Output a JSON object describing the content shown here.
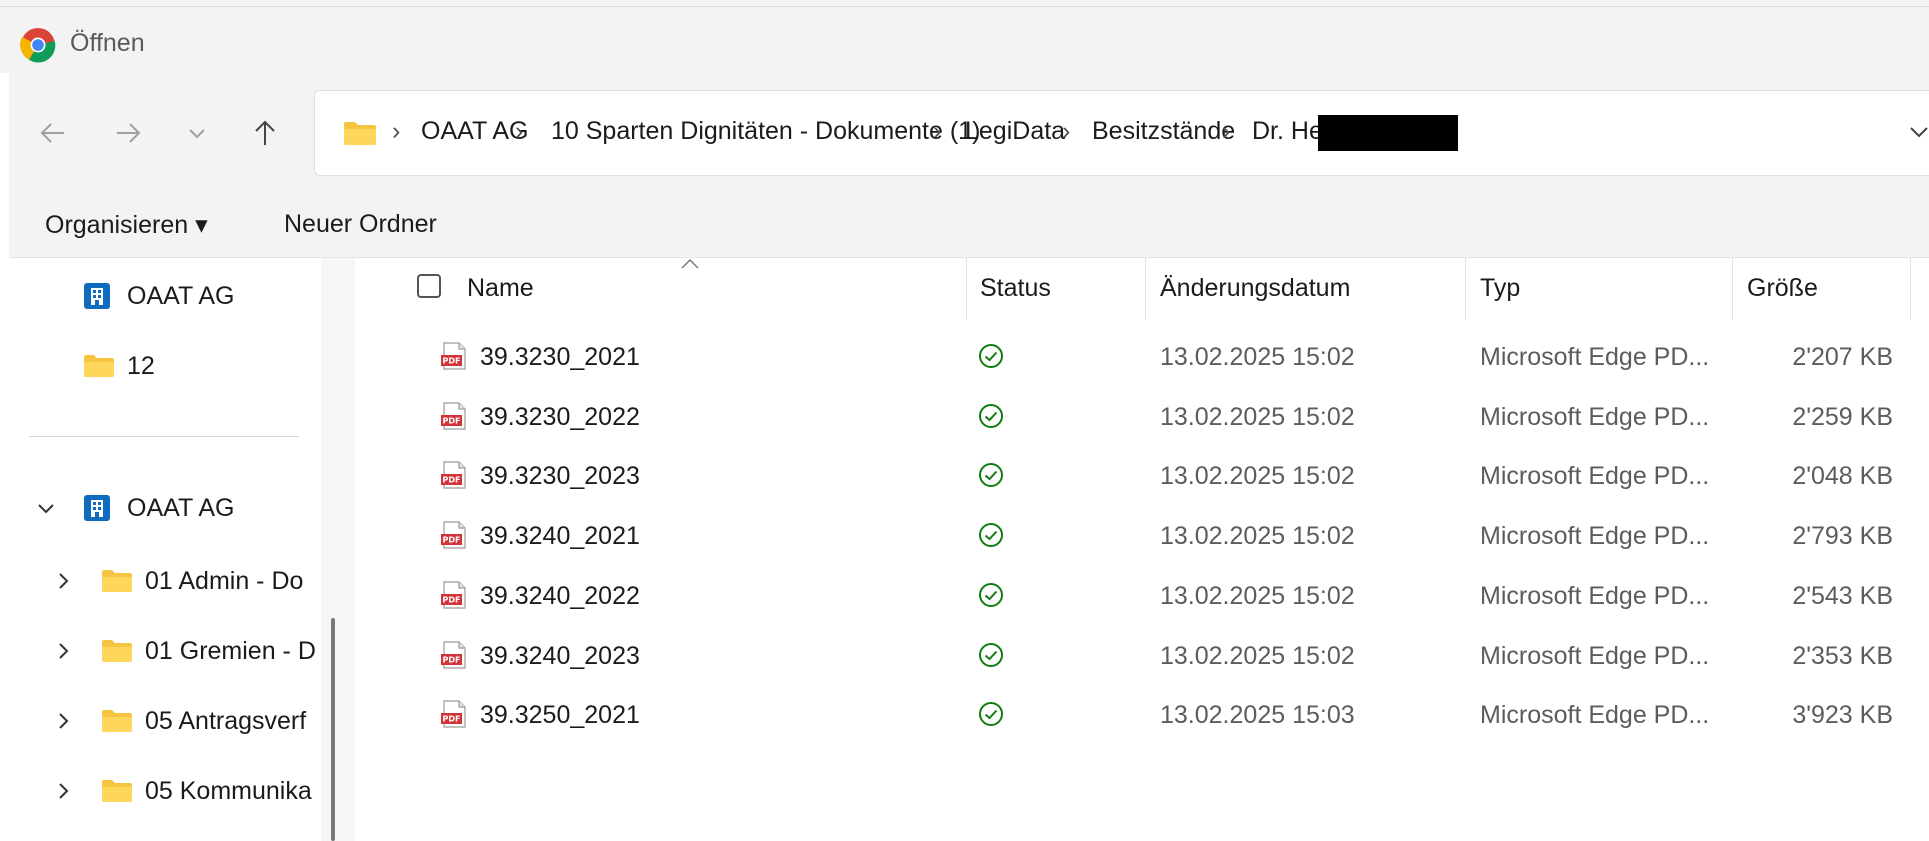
{
  "window": {
    "title": "Öffnen"
  },
  "nav": {
    "back_icon": "arrow-left-icon",
    "forward_icon": "arrow-right-icon",
    "recent_icon": "chevron-down-icon",
    "up_icon": "arrow-up-icon"
  },
  "breadcrumb": {
    "items": [
      "OAAT AG",
      "10 Sparten Dignitäten - Dokumente (1)",
      "LegiData",
      "Besitzstände",
      "Dr. He"
    ],
    "separator": "›"
  },
  "toolbar": {
    "organize_label": "Organisieren ▾",
    "new_folder_label": "Neuer Ordner"
  },
  "sidebar": {
    "items": [
      {
        "label": "OAAT AG",
        "icon": "building-icon"
      },
      {
        "label": "12",
        "icon": "folder-icon"
      },
      {
        "label": "OAAT AG",
        "icon": "building-icon",
        "expanded": true
      },
      {
        "label": "01 Admin - Do",
        "icon": "folder-icon"
      },
      {
        "label": "01 Gremien - D",
        "icon": "folder-icon"
      },
      {
        "label": "05 Antragsverf",
        "icon": "folder-icon"
      },
      {
        "label": "05 Kommunika",
        "icon": "folder-icon"
      }
    ]
  },
  "table": {
    "columns": [
      "Name",
      "Status",
      "Änderungsdatum",
      "Typ",
      "Größe"
    ],
    "rows": [
      {
        "name": "39.3230_2021",
        "status": "synced",
        "date": "13.02.2025 15:02",
        "type": "Microsoft Edge PD...",
        "size": "2'207 KB"
      },
      {
        "name": "39.3230_2022",
        "status": "synced",
        "date": "13.02.2025 15:02",
        "type": "Microsoft Edge PD...",
        "size": "2'259 KB"
      },
      {
        "name": "39.3230_2023",
        "status": "synced",
        "date": "13.02.2025 15:02",
        "type": "Microsoft Edge PD...",
        "size": "2'048 KB"
      },
      {
        "name": "39.3240_2021",
        "status": "synced",
        "date": "13.02.2025 15:02",
        "type": "Microsoft Edge PD...",
        "size": "2'793 KB"
      },
      {
        "name": "39.3240_2022",
        "status": "synced",
        "date": "13.02.2025 15:02",
        "type": "Microsoft Edge PD...",
        "size": "2'543 KB"
      },
      {
        "name": "39.3240_2023",
        "status": "synced",
        "date": "13.02.2025 15:02",
        "type": "Microsoft Edge PD...",
        "size": "2'353 KB"
      },
      {
        "name": "39.3250_2021",
        "status": "synced",
        "date": "13.02.2025 15:03",
        "type": "Microsoft Edge PD...",
        "size": "3'923 KB"
      }
    ]
  },
  "colors": {
    "accent_folder": "#f5c542",
    "status_green": "#107c10",
    "pdf_red": "#d13438",
    "building_blue": "#0f6cbd"
  }
}
